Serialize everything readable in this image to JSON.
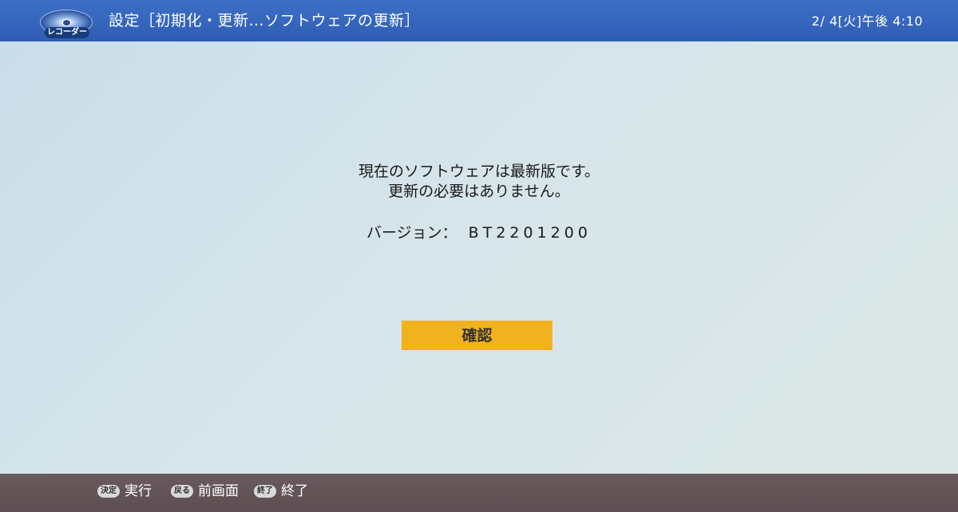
{
  "header": {
    "logo_text": "レコーダー",
    "title": "設定［初期化・更新…ソフトウェアの更新］",
    "datetime": "2/ 4[火]午後 4:10"
  },
  "message": {
    "line1": "現在のソフトウェアは最新版です。",
    "line2": "更新の必要はありません。",
    "version_label": "バージョン：",
    "version_value": "BT2201200"
  },
  "confirm_label": "確認",
  "footer": {
    "hints": [
      {
        "key": "決定",
        "label": "実行",
        "icon": "enter-key-icon"
      },
      {
        "key": "戻る",
        "label": "前画面",
        "icon": "back-key-icon"
      },
      {
        "key": "終了",
        "label": "終了",
        "icon": "exit-key-icon"
      }
    ]
  },
  "colors": {
    "header_bg": "#2f5db3",
    "button_bg": "#f0b21f",
    "footer_bg": "#5d4e52"
  }
}
